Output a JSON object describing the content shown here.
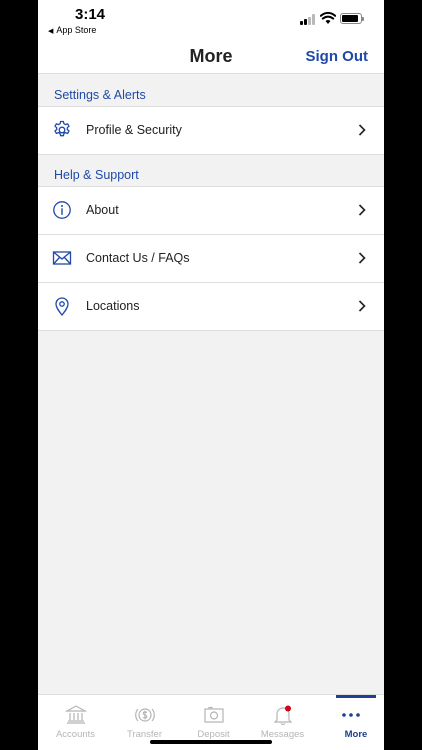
{
  "status_bar": {
    "time": "3:14",
    "back_app": "App Store"
  },
  "nav": {
    "title": "More",
    "sign_out": "Sign Out"
  },
  "sections": [
    {
      "title": "Settings & Alerts",
      "items": [
        {
          "label": "Profile & Security",
          "icon": "gear-icon"
        }
      ]
    },
    {
      "title": "Help & Support",
      "items": [
        {
          "label": "About",
          "icon": "info-icon"
        },
        {
          "label": "Contact Us / FAQs",
          "icon": "envelope-icon"
        },
        {
          "label": "Locations",
          "icon": "location-pin-icon"
        }
      ]
    }
  ],
  "tabs": [
    {
      "label": "Accounts",
      "icon": "bank-icon"
    },
    {
      "label": "Transfer",
      "icon": "transfer-dollar-icon"
    },
    {
      "label": "Deposit",
      "icon": "camera-icon"
    },
    {
      "label": "Messages",
      "icon": "bell-icon",
      "badge": true
    },
    {
      "label": "More",
      "icon": "more-dots-icon",
      "active": true
    }
  ],
  "colors": {
    "accent": "#1f49a8",
    "tab_active": "#1f3f8f",
    "tab_inactive": "#b5b5b5",
    "badge": "#d0021b"
  }
}
